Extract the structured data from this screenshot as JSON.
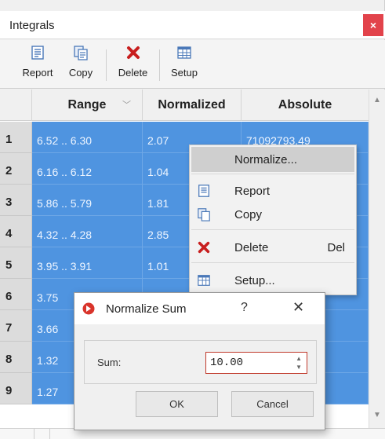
{
  "window": {
    "title": "Integrals",
    "close_glyph": "×"
  },
  "toolbar": {
    "items": [
      {
        "label": "Report",
        "icon": "report-icon"
      },
      {
        "label": "Copy",
        "icon": "copy-icon"
      },
      {
        "label": "Delete",
        "icon": "delete-icon"
      },
      {
        "label": "Setup",
        "icon": "setup-icon"
      }
    ]
  },
  "table": {
    "headers": {
      "range": "Range",
      "normalized": "Normalized",
      "absolute": "Absolute"
    },
    "rows": [
      {
        "num": "1",
        "range": "6.52 .. 6.30",
        "normalized": "2.07",
        "absolute": "71092793.49"
      },
      {
        "num": "2",
        "range": "6.16 .. 6.12",
        "normalized": "1.04",
        "absolute": ""
      },
      {
        "num": "3",
        "range": "5.86 .. 5.79",
        "normalized": "1.81",
        "absolute": ""
      },
      {
        "num": "4",
        "range": "4.32 .. 4.28",
        "normalized": "2.85",
        "absolute": ""
      },
      {
        "num": "5",
        "range": "3.95 .. 3.91",
        "normalized": "1.01",
        "absolute": ""
      },
      {
        "num": "6",
        "range": "3.75",
        "normalized": "",
        "absolute": ""
      },
      {
        "num": "7",
        "range": "3.66",
        "normalized": "",
        "absolute": ""
      },
      {
        "num": "8",
        "range": "1.32",
        "normalized": "",
        "absolute": ""
      },
      {
        "num": "9",
        "range": "1.27",
        "normalized": "",
        "absolute": ""
      }
    ]
  },
  "context_menu": {
    "normalize": "Normalize...",
    "report": "Report",
    "copy": "Copy",
    "delete": "Delete",
    "delete_shortcut": "Del",
    "setup": "Setup..."
  },
  "dialog": {
    "title": "Normalize Sum",
    "help": "?",
    "close": "✕",
    "sum_label": "Sum:",
    "sum_value": "10.00",
    "ok": "OK",
    "cancel": "Cancel"
  },
  "colors": {
    "selection": "#4f94e0",
    "close_button": "#e2434b",
    "delete_icon": "#c81e1e",
    "focus_border": "#c0392b"
  }
}
